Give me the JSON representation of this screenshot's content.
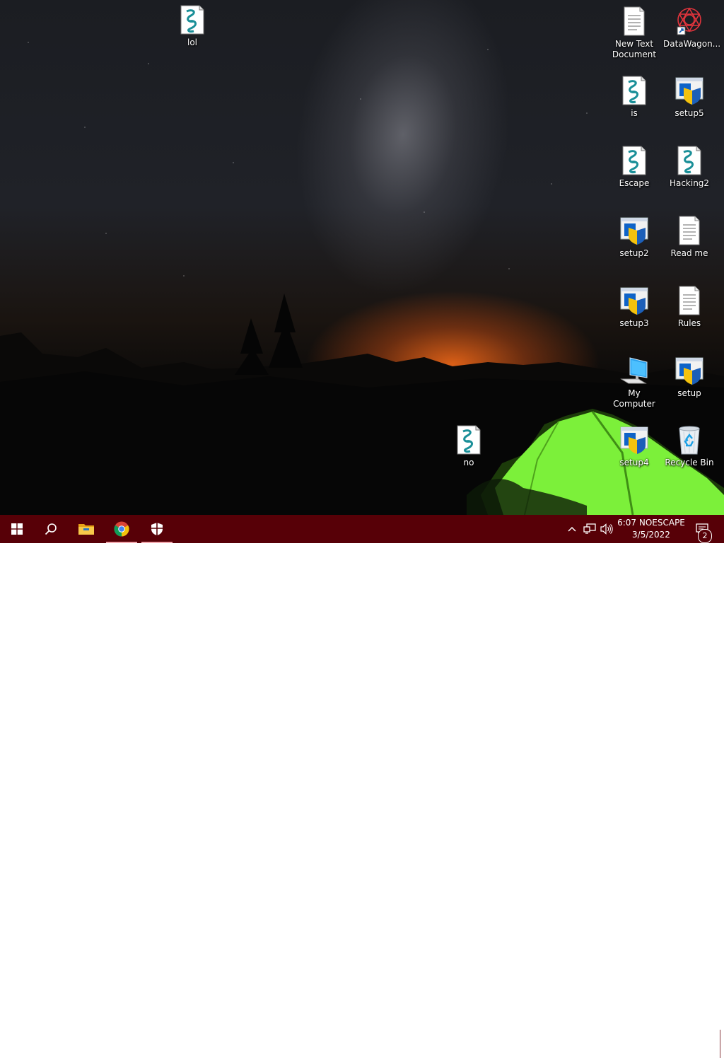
{
  "desktop_icons": [
    {
      "label": "lol",
      "icon": "script-icon"
    },
    {
      "label": "New Text Document",
      "icon": "text-document-icon"
    },
    {
      "label": "DataWagon...",
      "icon": "datawagon-shortcut-icon"
    },
    {
      "label": "is",
      "icon": "script-icon"
    },
    {
      "label": "setup5",
      "icon": "installer-icon"
    },
    {
      "label": "Escape",
      "icon": "script-icon"
    },
    {
      "label": "Hacking2",
      "icon": "script-icon"
    },
    {
      "label": "setup2",
      "icon": "installer-icon"
    },
    {
      "label": "Read me",
      "icon": "text-document-icon"
    },
    {
      "label": "setup3",
      "icon": "installer-icon"
    },
    {
      "label": "Rules",
      "icon": "text-document-icon"
    },
    {
      "label": "My Computer",
      "icon": "computer-icon"
    },
    {
      "label": "setup",
      "icon": "installer-icon"
    },
    {
      "label": "no",
      "icon": "script-icon"
    },
    {
      "label": "setup4",
      "icon": "installer-icon"
    },
    {
      "label": "Recycle Bin",
      "icon": "recycle-bin-icon"
    }
  ],
  "taskbar": {
    "apps": [
      {
        "icon": "windows-start-icon"
      },
      {
        "icon": "search-icon"
      },
      {
        "icon": "file-explorer-icon"
      },
      {
        "icon": "chrome-icon",
        "active": true
      },
      {
        "icon": "windows-security-icon",
        "active": true
      }
    ],
    "tray": [
      {
        "icon": "chevron-up-icon"
      },
      {
        "icon": "network-icon"
      },
      {
        "icon": "volume-icon"
      }
    ],
    "clock": {
      "time": "6:07 NOESCAPE",
      "date": "3/5/2022"
    },
    "notifications": {
      "icon": "action-center-icon",
      "count": "2"
    }
  },
  "colors": {
    "taskbar": "#570007",
    "active_indicator": "#f2a7ad",
    "tent": "#7cf03a"
  }
}
